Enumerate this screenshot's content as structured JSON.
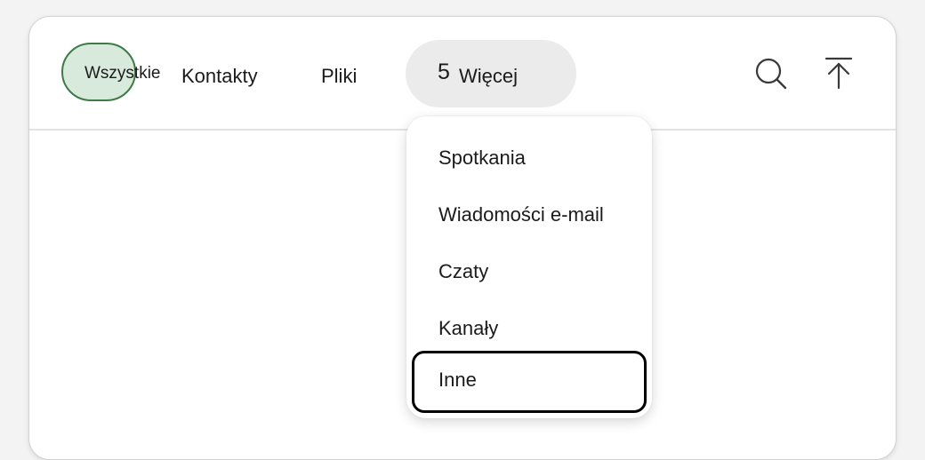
{
  "tabs": {
    "all_label": "Wszystkie",
    "contacts_label": "Kontakty",
    "files_label": "Pliki",
    "more_count": "5",
    "more_label": "Więcej"
  },
  "icons": {
    "search": "search-icon",
    "collapse": "arrow-up-to-line-icon"
  },
  "more_menu": {
    "items": [
      {
        "label": "Spotkania"
      },
      {
        "label": "Wiadomości e-mail"
      },
      {
        "label": "Czaty"
      },
      {
        "label": "Kanały"
      },
      {
        "label": "Inne"
      }
    ],
    "focused_index": 4
  },
  "colors": {
    "selected_fill": "#d7eadb",
    "selected_border": "#3f7a48",
    "more_pill": "#ebebeb",
    "focus_ring": "#000000"
  }
}
